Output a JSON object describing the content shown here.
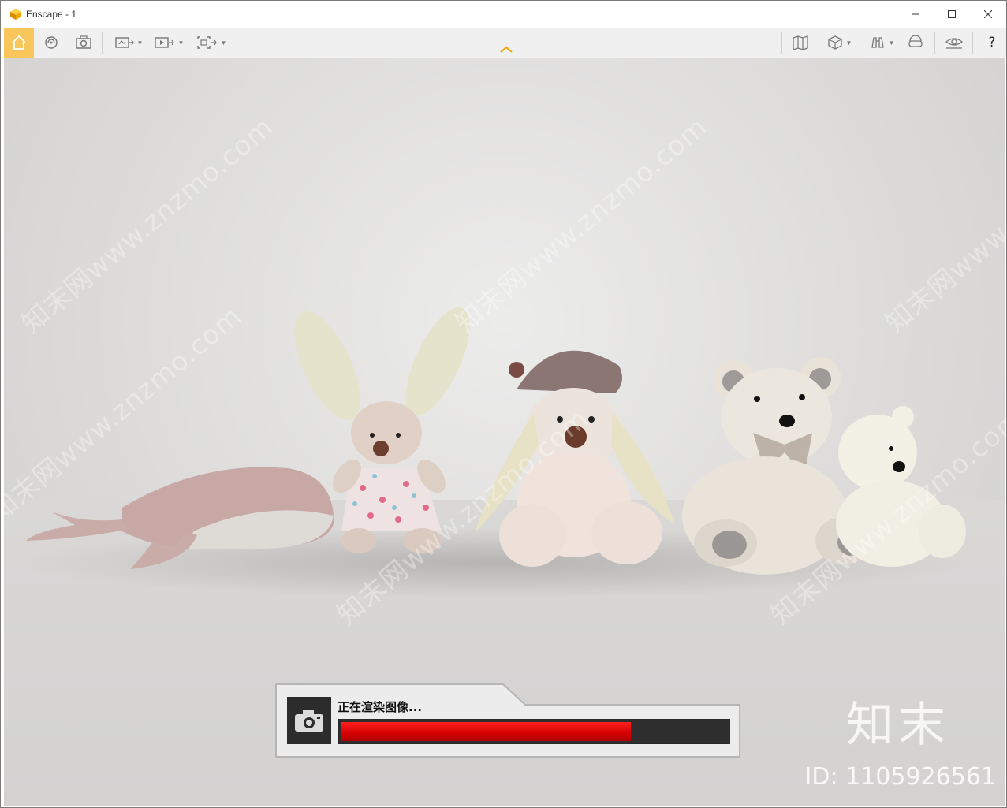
{
  "window": {
    "title": "Enscape - 1",
    "accent_color": "#f9c65c"
  },
  "toolbar": {
    "left_icons": [
      "home-icon",
      "orbit-icon",
      "screenshot-icon",
      "view-capture-icon",
      "video-editor-icon",
      "batch-render-icon"
    ],
    "right_icons": [
      "map-icon",
      "cube-view-icon",
      "binoculars-icon",
      "vr-headset-icon",
      "visual-settings-icon"
    ],
    "help_label": "?"
  },
  "render_dialog": {
    "status_text": "正在渲染图像...",
    "progress_percent": 75,
    "progress_color": "#e00000"
  },
  "watermarks": {
    "diagonal_text": "知末网www.znzmo.com",
    "brand": "知末",
    "id_text": "ID: 1105926561"
  }
}
